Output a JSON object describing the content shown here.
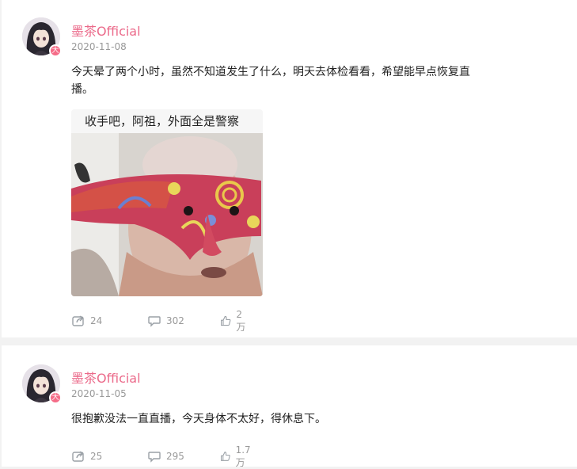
{
  "posts": [
    {
      "username": "墨茶Official",
      "date": "2020-11-08",
      "text_line1": "今天晕了两个小时，虽然不知道发生了什么，明天去体检看看，希望能早点恢复直",
      "text_line2": "播。",
      "image_caption": "收手吧，阿祖，外面全是警察",
      "share_count": "24",
      "comment_count": "302",
      "like_count": "2万"
    },
    {
      "username": "墨茶Official",
      "date": "2020-11-05",
      "text_line1": "很抱歉没法一直直播，今天身体不太好，得休息下。",
      "share_count": "25",
      "comment_count": "295",
      "like_count": "1.7万"
    }
  ],
  "badge_glyph": "大",
  "icons": {
    "share": "share-icon",
    "comment": "comment-icon",
    "like": "thumbs-up-icon"
  },
  "colors": {
    "username": "#eb6a8a",
    "badge": "#f56c88",
    "meta": "#999999"
  }
}
